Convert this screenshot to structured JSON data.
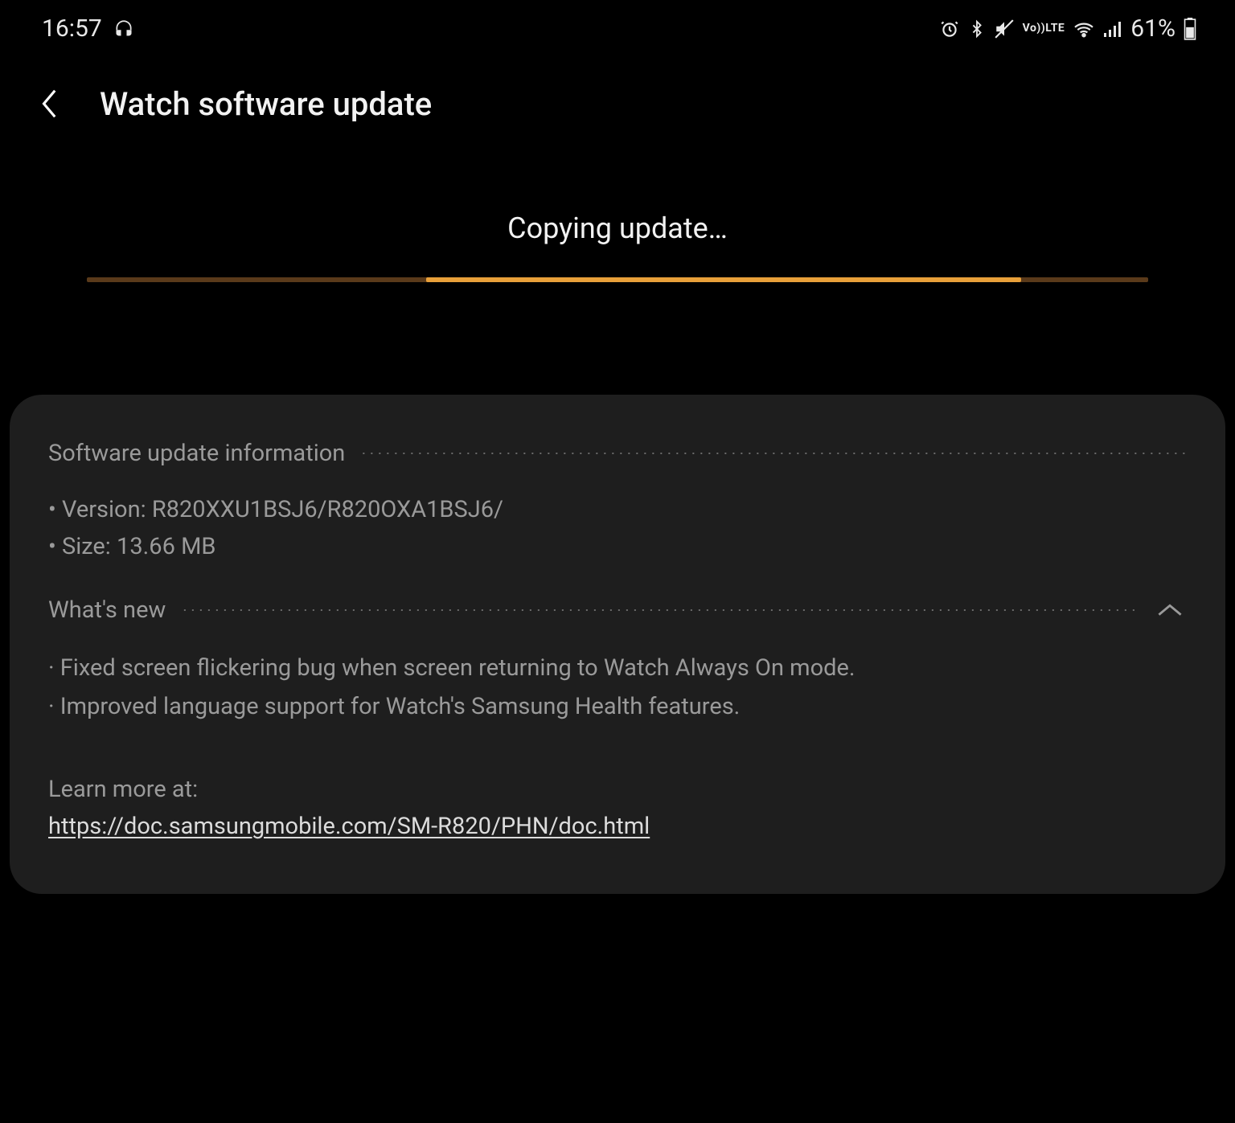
{
  "status": {
    "time": "16:57",
    "battery_text": "61%",
    "volte1": "Vo))",
    "volte2": "LTE"
  },
  "header": {
    "title": "Watch software update"
  },
  "progress": {
    "label": "Copying update…",
    "indeterminate_left_pct": 32,
    "indeterminate_width_pct": 56
  },
  "info": {
    "section_title": "Software update information",
    "version_label": "Version:",
    "version_value": "R820XXU1BSJ6/R820OXA1BSJ6/",
    "size_label": "Size:",
    "size_value": "13.66 MB"
  },
  "whats_new": {
    "section_title": "What's new",
    "changes": [
      "Fixed screen flickering bug when screen returning to Watch Always On mode.",
      "Improved language support for Watch's Samsung Health features."
    ]
  },
  "learn_more": {
    "label": "Learn more at:",
    "url": "https://doc.samsungmobile.com/SM-R820/PHN/doc.html"
  }
}
